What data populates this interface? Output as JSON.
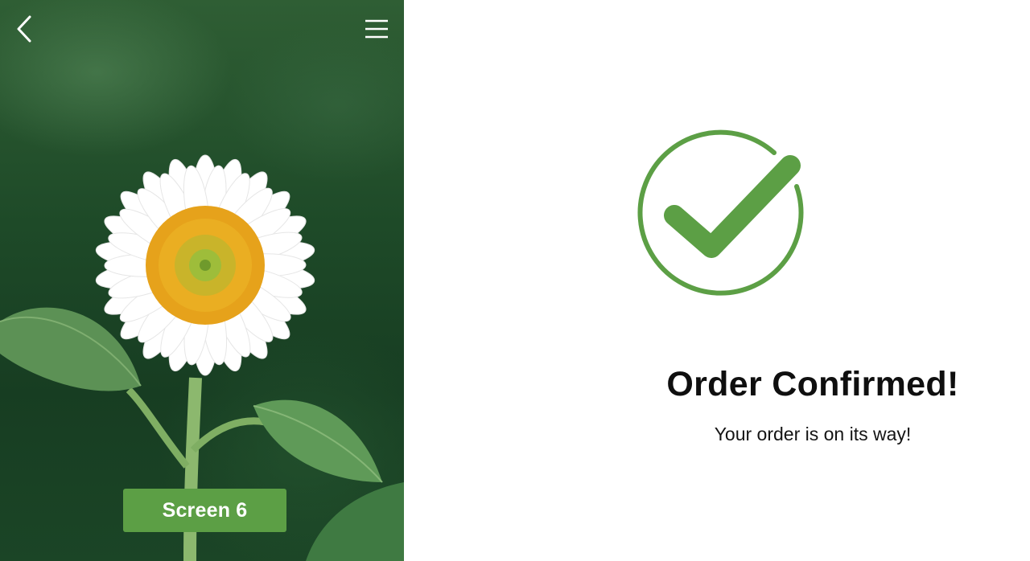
{
  "navigation": {
    "back_icon": "chevron-left-icon",
    "menu_icon": "hamburger-menu-icon"
  },
  "hero": {
    "badge_label": "Screen 6",
    "badge_color": "#5c9f45"
  },
  "confirmation": {
    "icon": "checkmark-circle-icon",
    "icon_color": "#5c9f45",
    "title": "Order Confirmed!",
    "message": "Your order is on its way!"
  }
}
